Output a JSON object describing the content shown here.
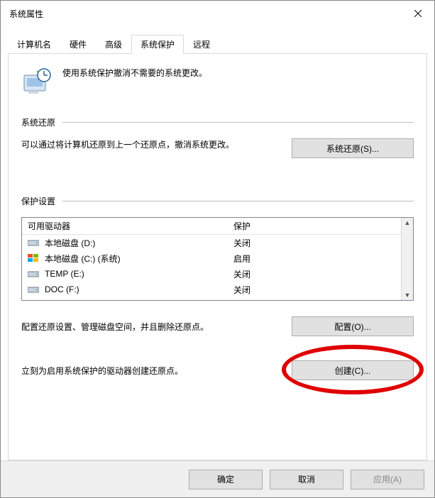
{
  "window": {
    "title": "系统属性"
  },
  "tabs": [
    {
      "label": "计算机名"
    },
    {
      "label": "硬件"
    },
    {
      "label": "高级"
    },
    {
      "label": "系统保护",
      "active": true
    },
    {
      "label": "远程"
    }
  ],
  "intro": {
    "text": "使用系统保护撤消不需要的系统更改。"
  },
  "restore": {
    "section_title": "系统还原",
    "desc": "可以通过将计算机还原到上一个还原点，撤消系统更改。",
    "button": "系统还原(S)..."
  },
  "protection": {
    "section_title": "保护设置",
    "header_drive": "可用驱动器",
    "header_status": "保护",
    "drives": [
      {
        "name": "本地磁盘 (D:)",
        "status": "关闭",
        "icon": "hdd"
      },
      {
        "name": "本地磁盘 (C:) (系统)",
        "status": "启用",
        "icon": "win"
      },
      {
        "name": "TEMP (E:)",
        "status": "关闭",
        "icon": "hdd"
      },
      {
        "name": "DOC (F:)",
        "status": "关闭",
        "icon": "hdd"
      }
    ],
    "configure_desc": "配置还原设置、管理磁盘空间，并且删除还原点。",
    "configure_button": "配置(O)...",
    "create_desc": "立刻为启用系统保护的驱动器创建还原点。",
    "create_button": "创建(C)..."
  },
  "footer": {
    "ok": "确定",
    "cancel": "取消",
    "apply": "应用(A)"
  }
}
